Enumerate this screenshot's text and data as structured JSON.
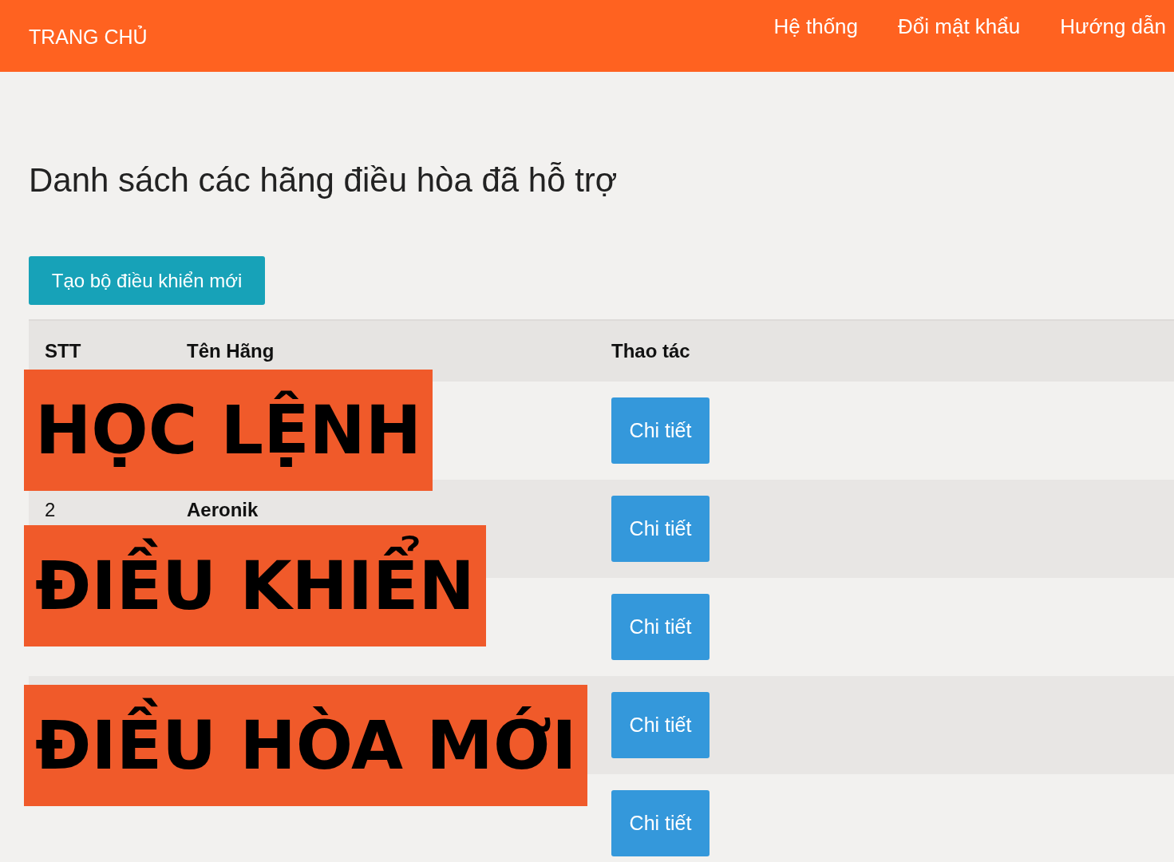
{
  "navbar": {
    "brand": "TRANG CHỦ",
    "links": [
      "Hệ thống",
      "Đổi mật khẩu",
      "Hướng dẫn"
    ]
  },
  "page_title": "Danh sách các hãng điều hòa đã hỗ trợ",
  "create_button": "Tạo bộ điều khiển mới",
  "table": {
    "columns": [
      "STT",
      "Tên Hãng",
      "Thao tác"
    ],
    "rows": [
      {
        "action": "Chi tiết"
      },
      {
        "stt": "2",
        "name": "Aeronik",
        "action": "Chi tiết"
      },
      {
        "action": "Chi tiết"
      },
      {
        "action": "Chi tiết"
      },
      {
        "action": "Chi tiết"
      }
    ]
  },
  "overlay_banners": [
    "HỌC LỆNH",
    "ĐIỀU KHIỂN",
    "ĐIỀU HÒA MỚI"
  ]
}
